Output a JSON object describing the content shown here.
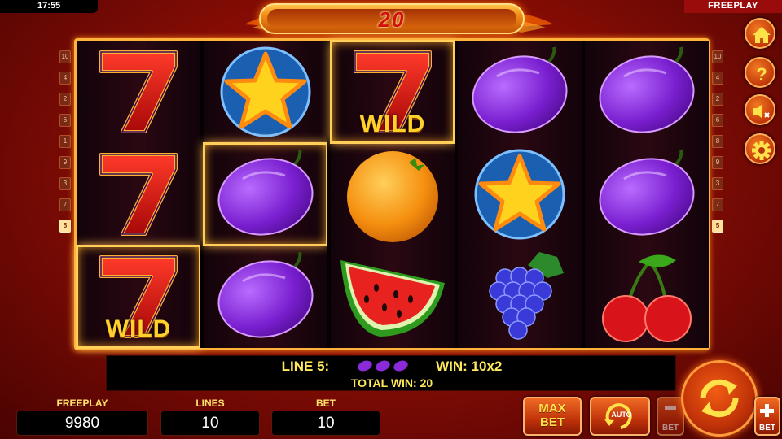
{
  "status_bar": {
    "time": "17:55",
    "mode": "FREEPLAY"
  },
  "header": {
    "lines_display": "20"
  },
  "side_menu": {
    "buttons": [
      {
        "name": "home",
        "icon": "home-icon"
      },
      {
        "name": "help",
        "icon": "question-icon"
      },
      {
        "name": "sound",
        "icon": "speaker-muted-icon"
      },
      {
        "name": "settings",
        "icon": "gear-icon"
      }
    ]
  },
  "line_markers_left": [
    "10",
    "4",
    "2",
    "6",
    "1",
    "9",
    "3",
    "7",
    "5"
  ],
  "line_markers_right": [
    "10",
    "4",
    "2",
    "6",
    "8",
    "9",
    "3",
    "7",
    "5"
  ],
  "reels": [
    {
      "symbols": [
        "seven",
        "seven",
        "seven-wild"
      ]
    },
    {
      "symbols": [
        "star",
        "plum",
        "plum"
      ]
    },
    {
      "symbols": [
        "seven-wild",
        "orange",
        "watermelon"
      ]
    },
    {
      "symbols": [
        "plum",
        "star",
        "grapes"
      ]
    },
    {
      "symbols": [
        "plum",
        "plum",
        "cherries"
      ]
    }
  ],
  "winning_cells": [
    [
      0,
      2
    ],
    [
      1,
      1
    ],
    [
      2,
      0
    ]
  ],
  "wild_text": "WILD",
  "win_info": {
    "line_text": "LINE 5:",
    "line_symbol": "plum-icon",
    "win_text": "WIN: 10x2",
    "total_win": "TOTAL WIN: 20"
  },
  "stats": {
    "freeplay": {
      "label": "FREEPLAY",
      "value": "9980"
    },
    "lines": {
      "label": "LINES",
      "value": "10"
    },
    "bet": {
      "label": "BET",
      "value": "10"
    }
  },
  "controls": {
    "max_bet_line1": "MAX",
    "max_bet_line2": "BET",
    "auto_label": "AUTO",
    "bet_minus_label": "BET",
    "bet_plus_label": "BET"
  },
  "colors": {
    "accent_gold": "#ffe85a",
    "frame_orange": "#ffb33a",
    "background_red": "#c1280e"
  }
}
